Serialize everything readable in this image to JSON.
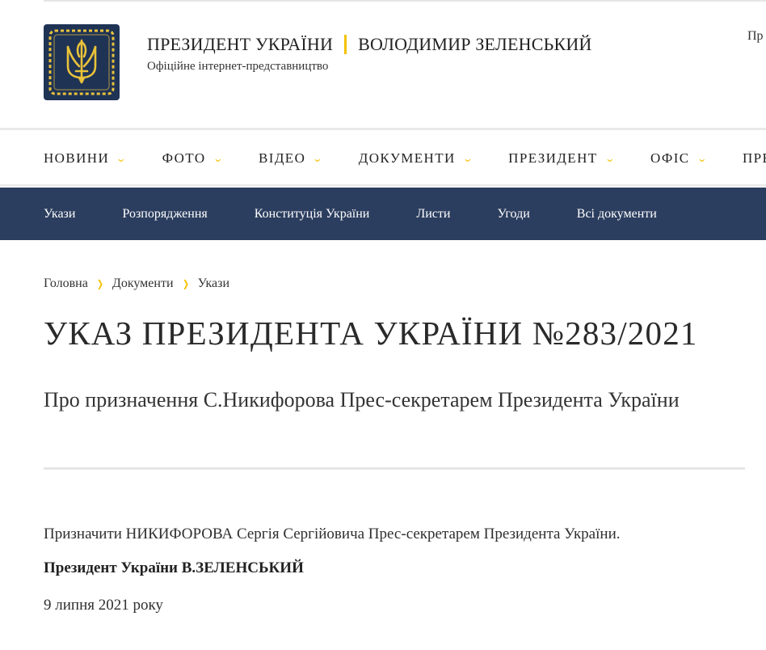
{
  "header": {
    "title_left": "ПРЕЗИДЕНТ УКРАЇНИ",
    "title_right": "ВОЛОДИМИР ЗЕЛЕНСЬКИЙ",
    "subtitle": "Офіційне інтернет-представництво",
    "right_cut_text": "Пр",
    "accent_color": "#f2c200",
    "logo_bg": "#1f3355"
  },
  "main_nav": {
    "items": [
      {
        "label": "НОВИНИ"
      },
      {
        "label": "ФОТО"
      },
      {
        "label": "ВІДЕО"
      },
      {
        "label": "ДОКУМЕНТИ"
      },
      {
        "label": "ПРЕЗИДЕНТ"
      },
      {
        "label": "ОФІС"
      },
      {
        "label": "ПРЕС"
      }
    ]
  },
  "sub_nav": {
    "bg_color": "#2c3e5f",
    "items": [
      {
        "label": "Укази"
      },
      {
        "label": "Розпорядження"
      },
      {
        "label": "Конституція України"
      },
      {
        "label": "Листи"
      },
      {
        "label": "Угоди"
      },
      {
        "label": "Всі документи"
      }
    ]
  },
  "breadcrumb": {
    "items": [
      "Головна",
      "Документи",
      "Укази"
    ]
  },
  "document": {
    "title": "УКАЗ ПРЕЗИДЕНТА УКРАЇНИ №283/2021",
    "subtitle": "Про призначення С.Никифорова Прес-секретарем Президента України",
    "body": "Призначити НИКИФОРОВА Сергія Сергійовича Прес-секретарем Президента України.",
    "signature": "Президент України В.ЗЕЛЕНСЬКИЙ",
    "date": "9 липня 2021 року"
  }
}
